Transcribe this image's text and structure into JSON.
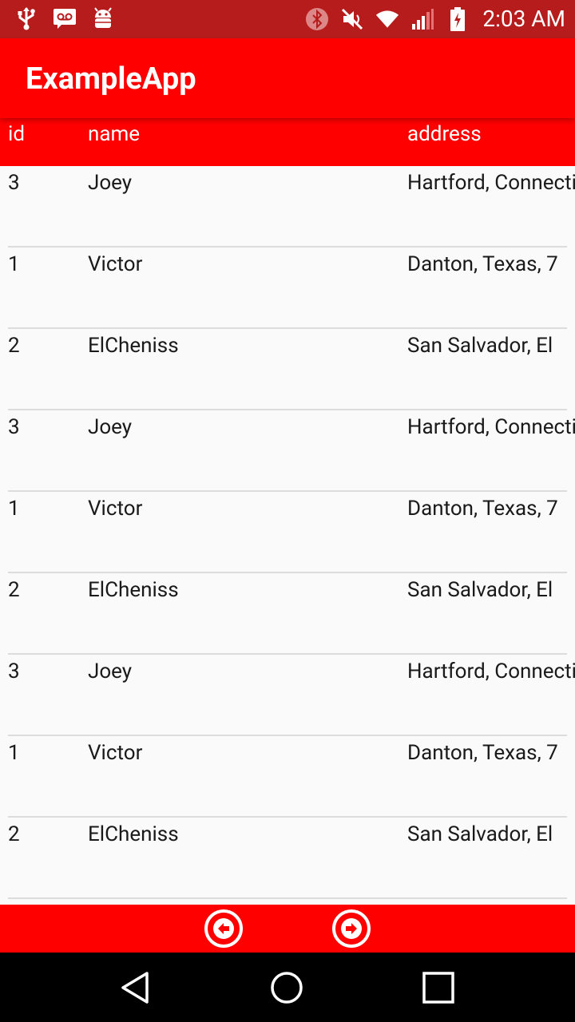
{
  "status_bar": {
    "time": "2:03 AM",
    "left_icons": [
      "usb-icon",
      "voicemail-icon",
      "android-debug-icon"
    ],
    "right_icons": [
      "bluetooth-icon",
      "mute-icon",
      "wifi-icon",
      "signal-icon",
      "battery-charging-icon"
    ]
  },
  "app_bar": {
    "title": "ExampleApp"
  },
  "table": {
    "headers": {
      "id": "id",
      "name": "name",
      "address": "address"
    },
    "rows": [
      {
        "id": "3",
        "name": "Joey",
        "address": "Hartford, Connecticut"
      },
      {
        "id": "1",
        "name": "Victor",
        "address": "Danton, Texas, 7"
      },
      {
        "id": "2",
        "name": "ElCheniss",
        "address": "San Salvador, El"
      },
      {
        "id": "3",
        "name": "Joey",
        "address": "Hartford, Connecticut"
      },
      {
        "id": "1",
        "name": "Victor",
        "address": "Danton, Texas, 7"
      },
      {
        "id": "2",
        "name": "ElCheniss",
        "address": "San Salvador, El"
      },
      {
        "id": "3",
        "name": "Joey",
        "address": "Hartford, Connecticut"
      },
      {
        "id": "1",
        "name": "Victor",
        "address": "Danton, Texas, 7"
      },
      {
        "id": "2",
        "name": "ElCheniss",
        "address": "San Salvador, El"
      }
    ]
  },
  "pagination": {
    "prev_icon": "arrow-left-circle-icon",
    "next_icon": "arrow-right-circle-icon"
  },
  "system_nav": {
    "icons": [
      "back-triangle-icon",
      "home-circle-icon",
      "recents-square-icon"
    ]
  },
  "colors": {
    "primary": "#ff0000",
    "primary_dark": "#b71c1c",
    "background": "#fafafa",
    "divider": "#dcdcdc"
  }
}
